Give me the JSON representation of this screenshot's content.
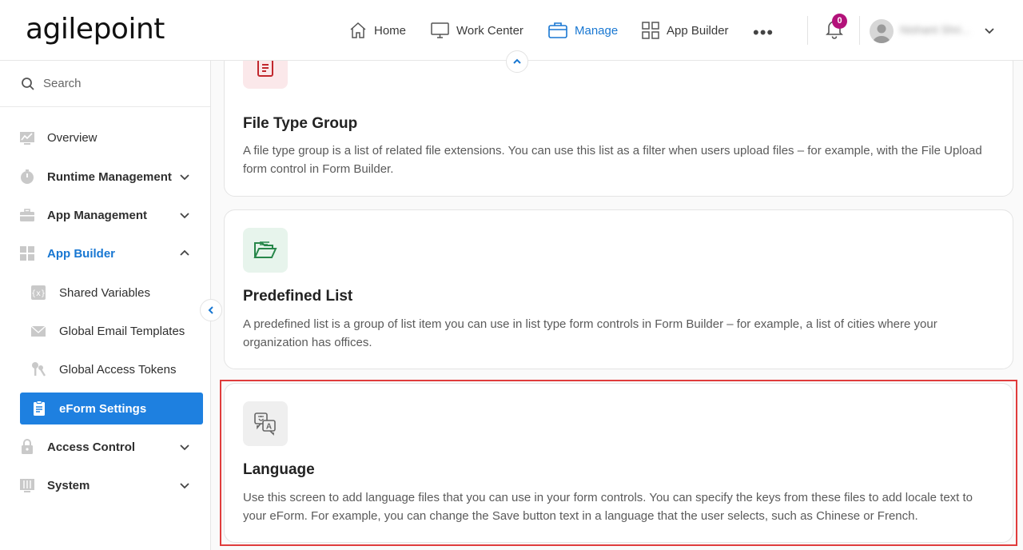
{
  "header": {
    "logo": "agilepoint",
    "nav": [
      {
        "label": "Home",
        "icon": "home-icon"
      },
      {
        "label": "Work Center",
        "icon": "monitor-icon"
      },
      {
        "label": "Manage",
        "icon": "briefcase-icon",
        "active": true
      },
      {
        "label": "App Builder",
        "icon": "grid-icon"
      }
    ],
    "more": "•••",
    "notifications_count": "0",
    "username": "Nishant Shri..."
  },
  "sidebar": {
    "search_label": "Search",
    "items": [
      {
        "label": "Overview",
        "icon": "chart-icon"
      },
      {
        "label": "Runtime Management",
        "icon": "stopwatch-icon"
      },
      {
        "label": "App Management",
        "icon": "toolbox-icon"
      },
      {
        "label": "App Builder",
        "icon": "dashboard-icon"
      },
      {
        "label": "Shared Variables",
        "icon": "variable-icon"
      },
      {
        "label": "Global Email Templates",
        "icon": "envelope-icon"
      },
      {
        "label": "Global Access Tokens",
        "icon": "keys-icon"
      },
      {
        "label": "eForm Settings",
        "icon": "clipboard-icon"
      },
      {
        "label": "Access Control",
        "icon": "lock-icon"
      },
      {
        "label": "System",
        "icon": "sliders-icon"
      }
    ]
  },
  "cards": [
    {
      "title": "File Type Group",
      "description": "A file type group is a list of related file extensions. You can use this list as a filter when users upload files – for example, with the File Upload form control in Form Builder.",
      "icon": "file-list-icon"
    },
    {
      "title": "Predefined List",
      "description": "A predefined list is a group of list item you can use in list type form controls in Form Builder – for example, a list of cities where your organization has offices.",
      "icon": "folder-open-icon"
    },
    {
      "title": "Language",
      "description": "Use this screen to add language files that you can use in your form controls. You can specify the keys from these files to add locale text to your eForm. For example, you can change the Save button text in a language that the user selects, such as Chinese or French.",
      "icon": "translate-icon"
    }
  ],
  "colors": {
    "accent": "#1877d2",
    "selected_bg": "#1e80e0",
    "highlight": "#e03c3c",
    "badge": "#b3127a"
  }
}
